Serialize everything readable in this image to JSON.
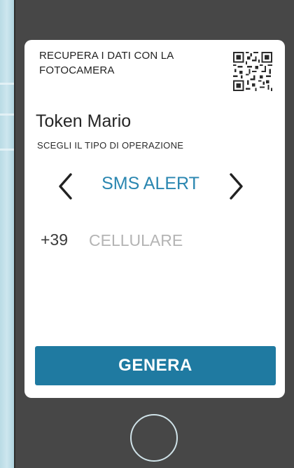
{
  "qr_section": {
    "title_line1": "RECUPERA I DATI CON LA",
    "title_line2": "FOTOCAMERA",
    "icon": "qr-code-icon"
  },
  "token": {
    "name": "Token Mario"
  },
  "operation": {
    "label": "SCEGLI IL TIPO DI OPERAZIONE",
    "selected": "SMS ALERT",
    "prev_icon": "chevron-left-icon",
    "next_icon": "chevron-right-icon"
  },
  "phone": {
    "prefix": "+39",
    "placeholder": "CELLULARE",
    "value": ""
  },
  "actions": {
    "generate_label": "GENERA"
  },
  "colors": {
    "accent": "#2a86b0",
    "button": "#1f7aa1",
    "device": "#474747",
    "screen": "#ffffff"
  }
}
